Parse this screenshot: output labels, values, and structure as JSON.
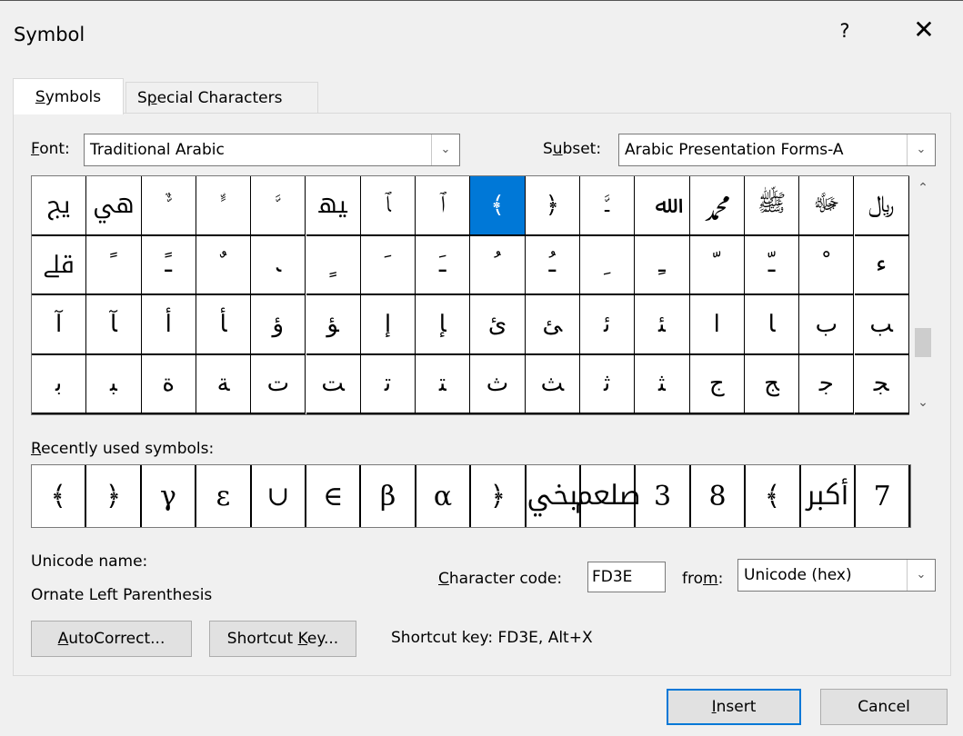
{
  "window": {
    "title": "Symbol",
    "help_label": "?",
    "close_label": "✕"
  },
  "tabs": {
    "symbols": {
      "label_u": "S",
      "label_rest": "ymbols"
    },
    "special": {
      "label_pre": "S",
      "label_u": "p",
      "label_rest": "ecial Characters"
    }
  },
  "font": {
    "label_u": "F",
    "label_rest": "ont:",
    "value": "Traditional Arabic"
  },
  "subset": {
    "label_pre": "S",
    "label_u": "u",
    "label_rest": "bset:",
    "value": "Arabic Presentation Forms-A"
  },
  "grid": {
    "rows": [
      [
        "ﱕ",
        "ﱔ",
        "ﱞ",
        "ﱟ",
        "ﱠ",
        "ﳱ",
        "ﭑ",
        "ﭐ",
        "﴾",
        "﴿",
        "ﳲ",
        "ﷲ",
        "ﷴ",
        "ﷺ",
        "ﷻ",
        "﷼"
      ],
      [
        "ﷱ",
        "ﹰ",
        "ﹱ",
        "ﹲ",
        "ﹳ",
        "ﹴ",
        "ﹶ",
        "ﹷ",
        "ﹸ",
        "ﹹ",
        "ﹺ",
        "ﹻ",
        "ﹼ",
        "ﹽ",
        "ﹾ",
        "ﺀ"
      ],
      [
        "ﺁ",
        "ﺂ",
        "ﺃ",
        "ﺄ",
        "ﺅ",
        "ﺆ",
        "ﺇ",
        "ﺈ",
        "ﺉ",
        "ﺊ",
        "ﺋ",
        "ﺌ",
        "ﺍ",
        "ﺎ",
        "ﺏ",
        "ﺐ"
      ],
      [
        "ﺑ",
        "ﺒ",
        "ﺓ",
        "ﺔ",
        "ﺕ",
        "ﺖ",
        "ﺗ",
        "ﺘ",
        "ﺙ",
        "ﺚ",
        "ﺛ",
        "ﺜ",
        "ﺝ",
        "ﺞ",
        "ﺟ",
        "ﺠ"
      ]
    ],
    "selected_row": 0,
    "selected_col": 8
  },
  "recent": {
    "label_u": "R",
    "label_rest": "ecently used symbols:",
    "symbols": [
      "﴾",
      "﴿",
      "γ",
      "ε",
      "∪",
      "∈",
      "β",
      "α",
      "﴿",
      "ﶞ",
      "ﷵ",
      "3",
      "8",
      "﴾",
      "ﷳ",
      "7"
    ]
  },
  "unicode": {
    "name_label": "Unicode name:",
    "name_value": "Ornate Left Parenthesis"
  },
  "charcode": {
    "label_u": "C",
    "label_rest": "haracter code:",
    "value": "FD3E"
  },
  "from": {
    "label_pre": "fro",
    "label_u": "m",
    "label_rest": ":",
    "value": "Unicode (hex)"
  },
  "buttons": {
    "autocorrect_u": "A",
    "autocorrect_rest": "utoCorrect...",
    "shortcut_pre": "Shortcut ",
    "shortcut_u": "K",
    "shortcut_rest": "ey...",
    "insert_u": "I",
    "insert_rest": "nsert",
    "cancel": "Cancel"
  },
  "shortcut_text": "Shortcut key: FD3E, Alt+X"
}
